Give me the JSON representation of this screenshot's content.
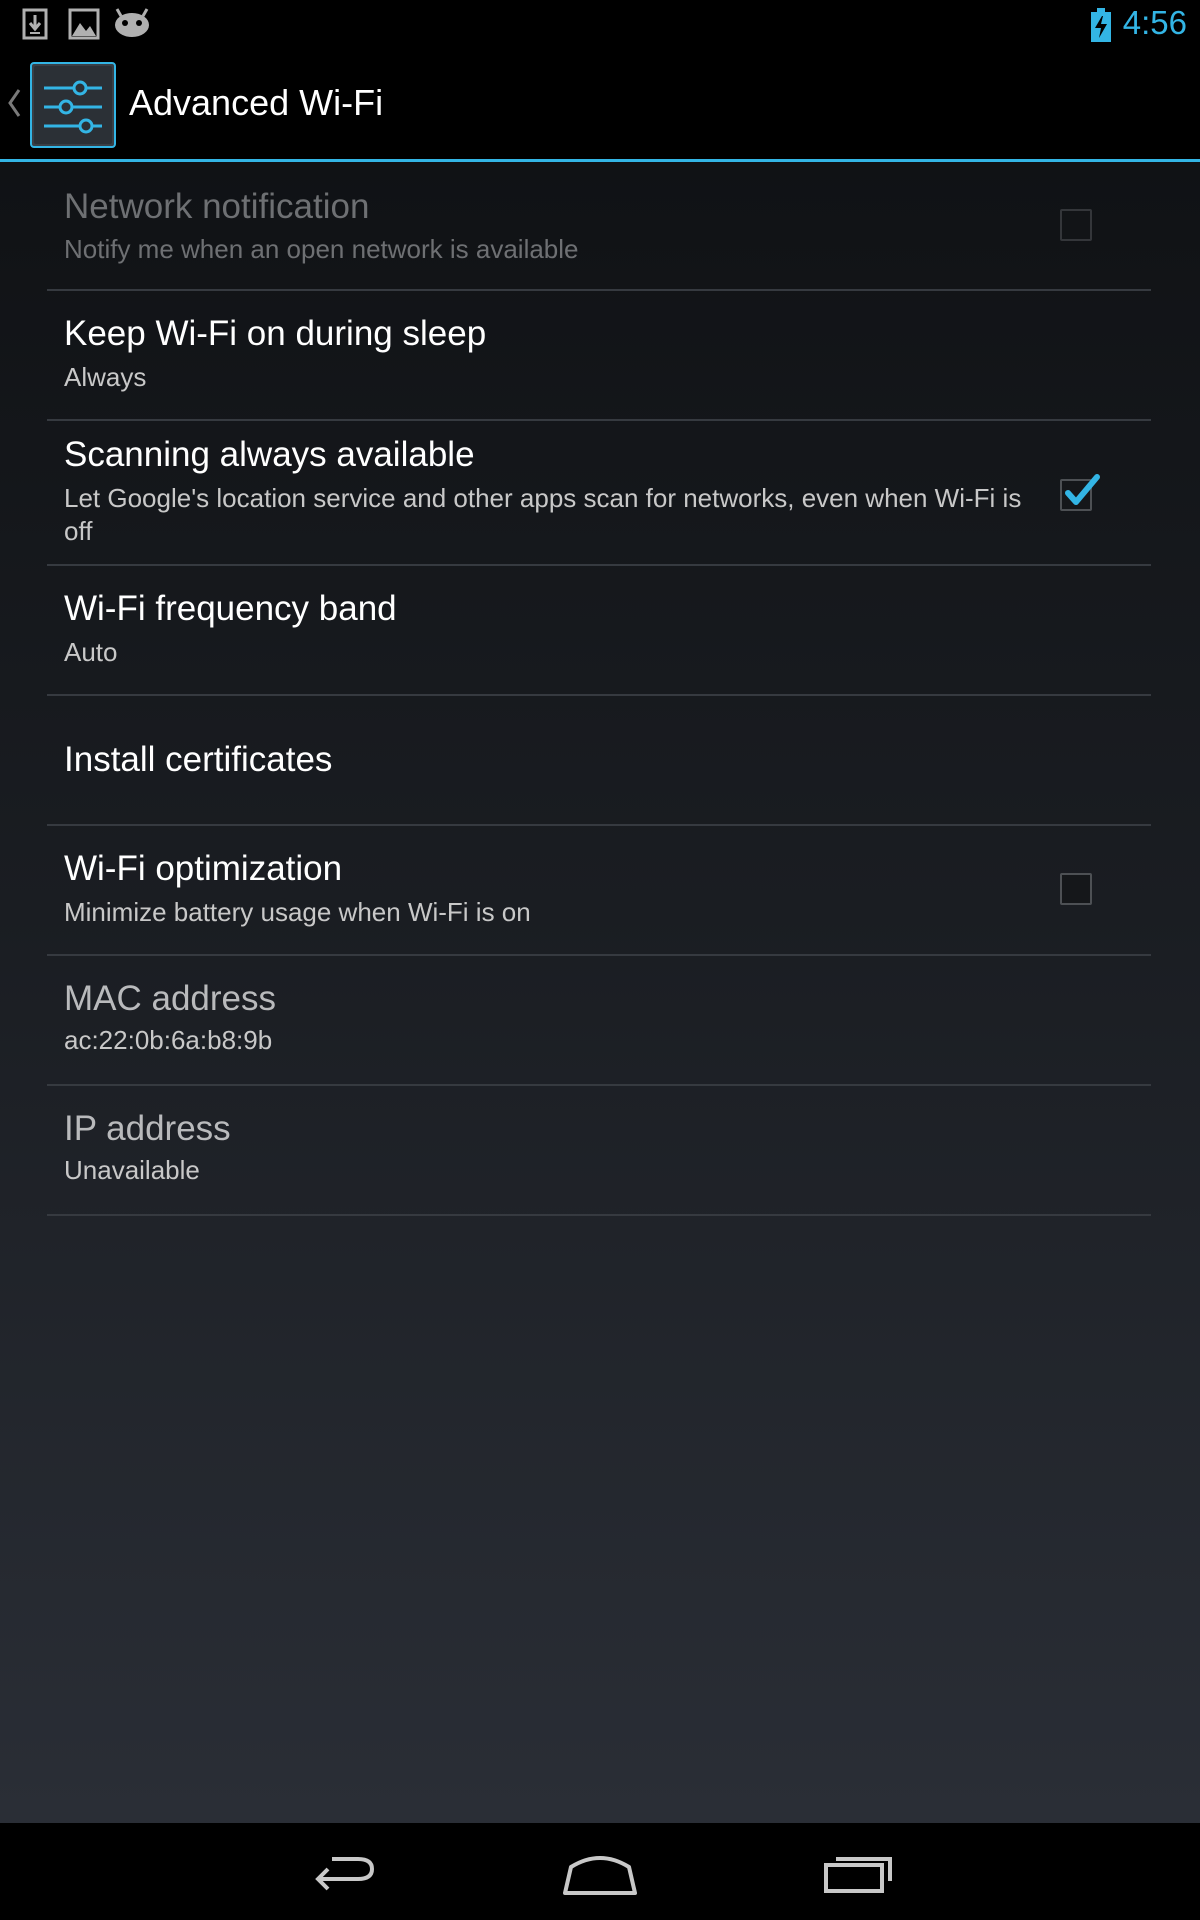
{
  "status_bar": {
    "time": "4:56",
    "clock_color": "#33b5e5",
    "notification_icons": [
      "download-icon",
      "image-icon",
      "android-icon"
    ],
    "battery_icon": "battery-charging-icon"
  },
  "action_bar": {
    "title": "Advanced Wi-Fi",
    "app_icon": "settings-icon",
    "up_icon": "up-caret-icon",
    "accent_color": "#33b5e5"
  },
  "preferences": [
    {
      "title": "Network notification",
      "summary": "Notify me when an open network is available",
      "has_checkbox": true,
      "checked": false,
      "enabled": false
    },
    {
      "title": "Keep Wi-Fi on during sleep",
      "summary": "Always",
      "has_checkbox": false,
      "enabled": true
    },
    {
      "title": "Scanning always available",
      "summary": "Let Google's location service and other apps scan for networks, even when Wi-Fi is off",
      "has_checkbox": true,
      "checked": true,
      "enabled": true
    },
    {
      "title": "Wi-Fi frequency band",
      "summary": "Auto",
      "has_checkbox": false,
      "enabled": true
    },
    {
      "title": "Install certificates",
      "has_checkbox": false,
      "enabled": true
    },
    {
      "title": "Wi-Fi optimization",
      "summary": "Minimize battery usage when Wi-Fi is on",
      "has_checkbox": true,
      "checked": false,
      "enabled": true
    },
    {
      "title": "MAC address",
      "summary": "ac:22:0b:6a:b8:9b",
      "has_checkbox": false,
      "enabled": false
    },
    {
      "title": "IP address",
      "summary": "Unavailable",
      "has_checkbox": false,
      "enabled": false
    }
  ],
  "nav_bar": {
    "buttons": [
      "back-icon",
      "home-icon",
      "recent-apps-icon"
    ]
  }
}
